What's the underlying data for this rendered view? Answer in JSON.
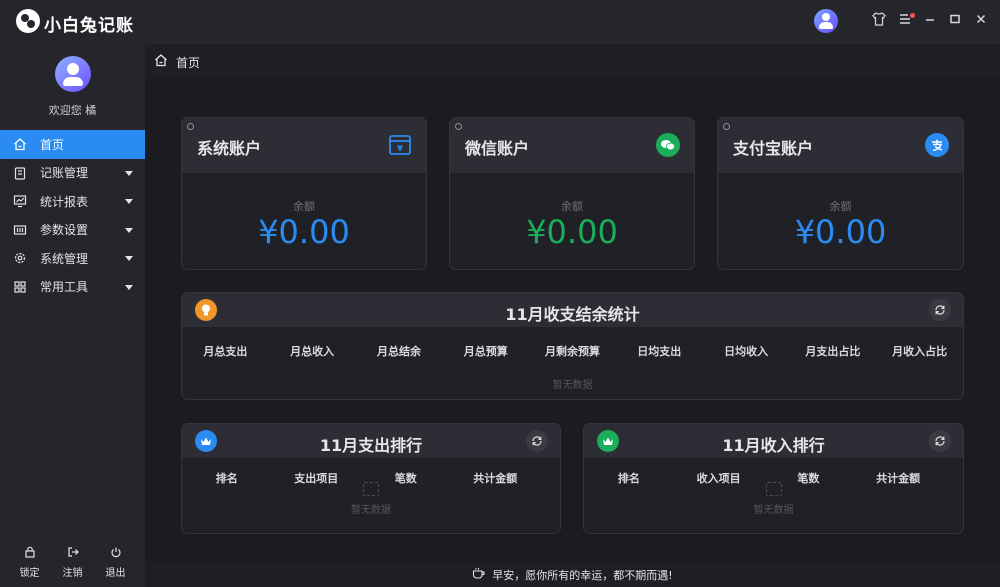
{
  "app": {
    "title": "小白兔记账"
  },
  "titlebar": {
    "icons": [
      "user-avatar-icon",
      "shirt-icon",
      "menu-icon",
      "minimize-icon",
      "maximize-icon",
      "close-icon"
    ]
  },
  "sidebar": {
    "welcome": "欢迎您 橘",
    "items": [
      {
        "label": "首页",
        "icon": "home-icon",
        "active": true
      },
      {
        "label": "记账管理",
        "icon": "clipboard-icon"
      },
      {
        "label": "统计报表",
        "icon": "chart-icon"
      },
      {
        "label": "参数设置",
        "icon": "sliders-icon"
      },
      {
        "label": "系统管理",
        "icon": "gear-icon"
      },
      {
        "label": "常用工具",
        "icon": "grid-icon"
      }
    ],
    "bottom": [
      {
        "label": "锁定",
        "icon": "lock-icon"
      },
      {
        "label": "注销",
        "icon": "logout-icon"
      },
      {
        "label": "退出",
        "icon": "power-icon"
      }
    ]
  },
  "breadcrumb": {
    "label": "首页"
  },
  "accounts": [
    {
      "title": "系统账户",
      "balance_label": "余额",
      "amount": "¥0.00",
      "color": "#2a8bf2",
      "icon": "wallet-icon"
    },
    {
      "title": "微信账户",
      "balance_label": "余额",
      "amount": "¥0.00",
      "color": "#1aad5a",
      "icon": "wechat-icon"
    },
    {
      "title": "支付宝账户",
      "balance_label": "余额",
      "amount": "¥0.00",
      "color": "#2a8bf2",
      "icon": "alipay-icon"
    }
  ],
  "summary": {
    "title": "11月收支结余统计",
    "columns": [
      "月总支出",
      "月总收入",
      "月总结余",
      "月总预算",
      "月剩余预算",
      "日均支出",
      "日均收入",
      "月支出占比",
      "月收入占比"
    ],
    "empty": "暂无数据"
  },
  "expense_rank": {
    "title": "11月支出排行",
    "columns": [
      "排名",
      "支出项目",
      "笔数",
      "共计金额"
    ],
    "empty": "暂无数据"
  },
  "income_rank": {
    "title": "11月收入排行",
    "columns": [
      "排名",
      "收入项目",
      "笔数",
      "共计金额"
    ],
    "empty": "暂无数据"
  },
  "footer": {
    "text": "早安，愿你所有的幸运，都不期而遇!"
  }
}
